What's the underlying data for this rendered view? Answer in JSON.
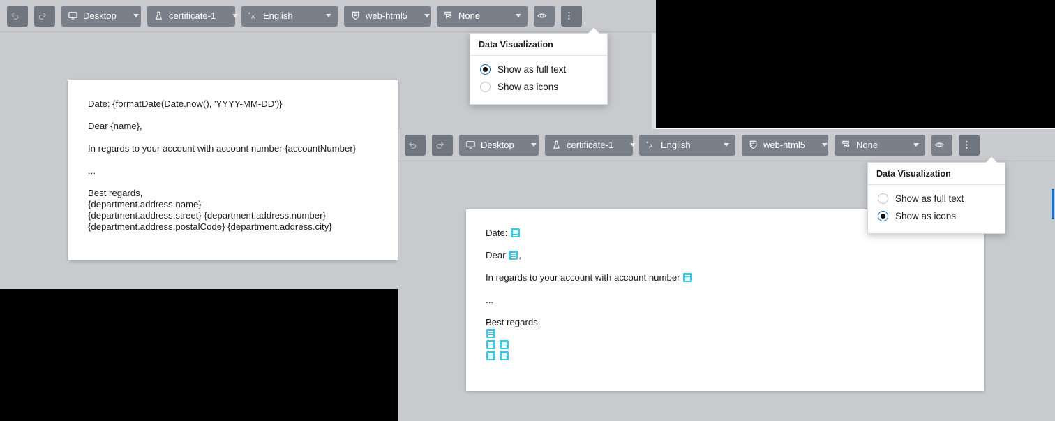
{
  "app": {
    "background_color": "#c8cacd",
    "toolbar_color": "#c8cacd",
    "button_color": "#7a8089",
    "token_color": "#41c4e0",
    "accent_color": "#1565c0"
  },
  "toolbar": {
    "undo_label": "",
    "redo_label": "",
    "device_label": "Desktop",
    "certificate_label": "certificate-1",
    "language_label": "English",
    "format_label": "web-html5",
    "filter_label": "None",
    "preview_label": "",
    "more_label": ""
  },
  "popover": {
    "title": "Data Visualization",
    "options": [
      {
        "label": "Show as full text"
      },
      {
        "label": "Show as icons"
      }
    ],
    "selected_top": "Show as full text",
    "selected_bottom": "Show as icons"
  },
  "document_full_text": {
    "line_date": "Date: {formatDate(Date.now(), 'YYYY-MM-DD')}",
    "line_greeting": "Dear {name},",
    "line_body": "In regards to your account with account number {accountNumber}",
    "line_ellipsis": "...",
    "line_closing": "Best regards,",
    "address": [
      "{department.address.name}",
      "{department.address.street} {department.address.number}",
      "{department.address.postalCode} {department.address.city}"
    ]
  },
  "document_icons": {
    "line_date_prefix": "Date:",
    "line_greeting_prefix": "Dear",
    "line_greeting_suffix": ",",
    "line_body_prefix": "In regards to your account with account number",
    "line_ellipsis": "...",
    "line_closing": "Best regards,",
    "address_rows": [
      {
        "tokens": 1
      },
      {
        "tokens": 2
      },
      {
        "tokens": 2
      }
    ],
    "token_icon": "data-token-icon"
  }
}
